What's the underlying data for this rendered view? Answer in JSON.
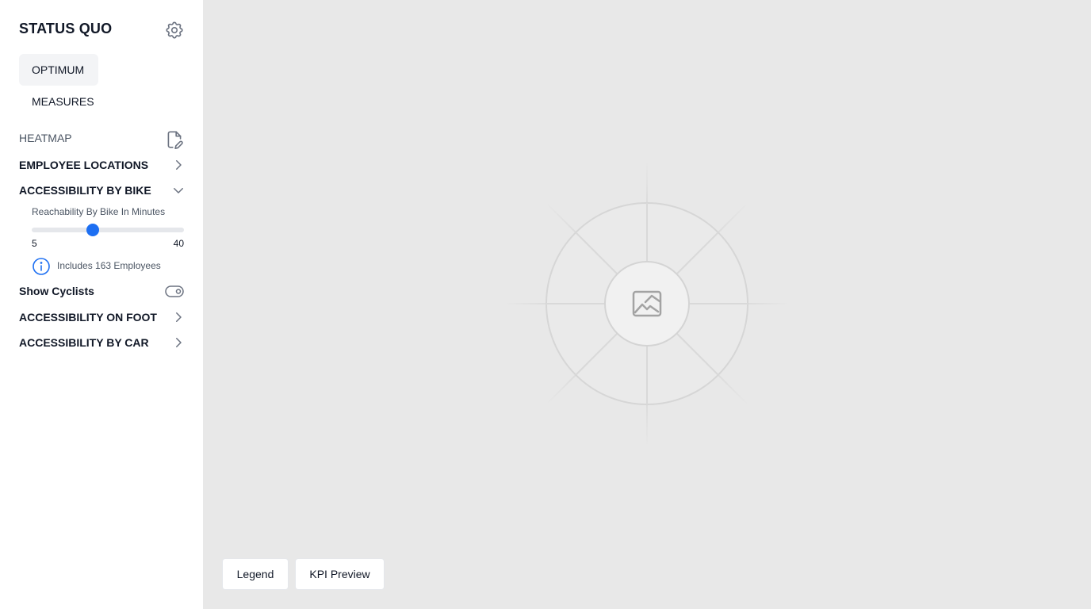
{
  "sidebar": {
    "title": "STATUS QUO",
    "nav": {
      "optimum": "OPTIMUM",
      "measures": "MEASURES"
    },
    "heatmap_label": "HEATMAP",
    "sections": {
      "employee_locations": "EMPLOYEE LOCATIONS",
      "accessibility_bike": "ACCESSIBILITY BY BIKE",
      "accessibility_foot": "ACCESSIBILITY ON FOOT",
      "accessibility_car": "ACCESSIBILITY BY CAR"
    },
    "bike_slider": {
      "title": "Reachability By Bike In Minutes",
      "min_label": "5",
      "max_label": "40",
      "min": 5,
      "max": 40,
      "value": 19
    },
    "info_text": "Includes 163 Employees",
    "toggle": {
      "label": "Show Cyclists",
      "on": false
    }
  },
  "main": {
    "buttons": {
      "legend": "Legend",
      "kpi_preview": "KPI Preview"
    }
  },
  "icons": {
    "settings": "gear-icon",
    "heatmap_edit": "document-edit-icon",
    "collapsed": "chevron-right-icon",
    "expanded": "chevron-down-icon",
    "info": "info-icon",
    "toggle": "toggle-off-icon",
    "map_placeholder": "image-placeholder-icon"
  },
  "colors": {
    "accent": "#1d6ff2",
    "map_background": "#e8e8e8",
    "active_nav_background": "#f3f4f6",
    "muted_text": "#4b5563"
  }
}
